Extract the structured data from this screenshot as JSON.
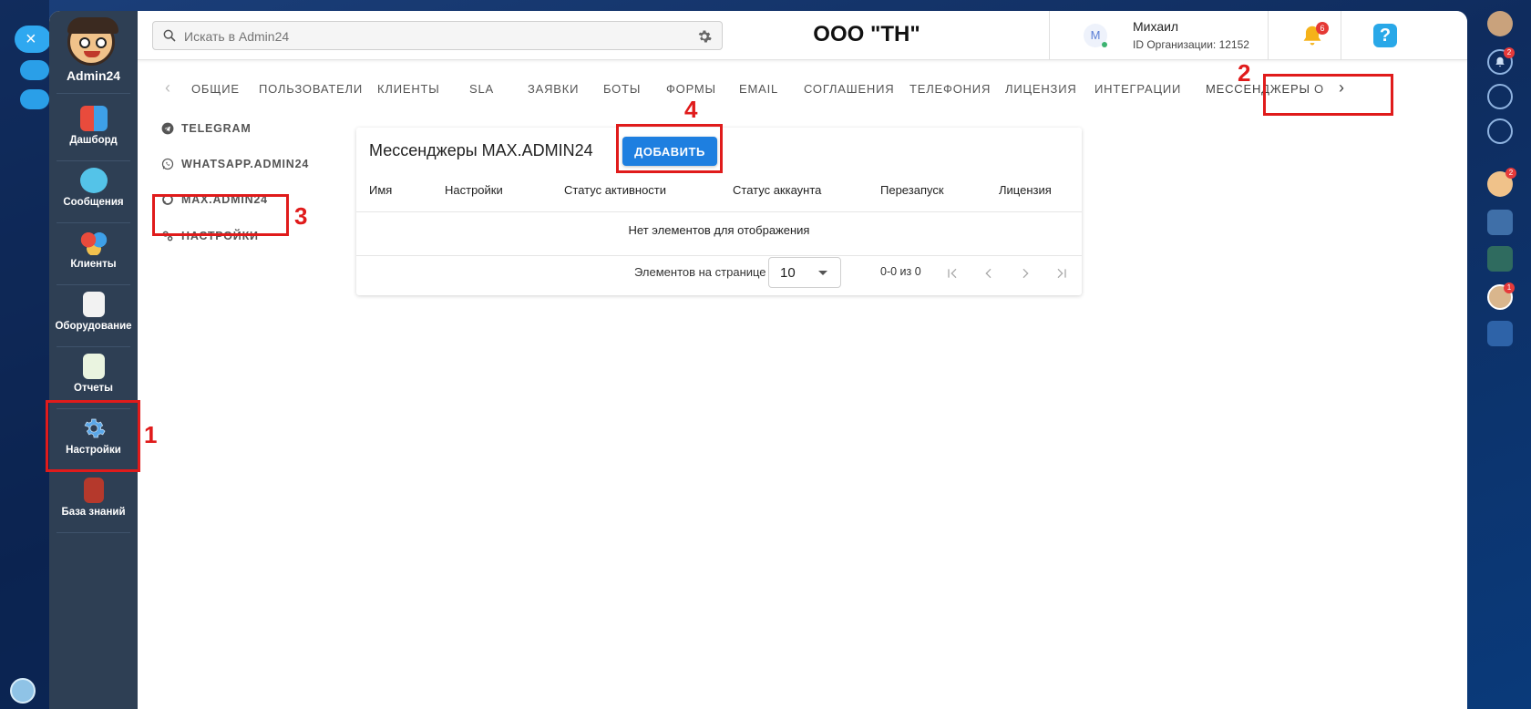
{
  "app": {
    "name": "Admin24",
    "org_title": "ООО \"ТН\""
  },
  "search": {
    "placeholder": "Искать в Admin24"
  },
  "user": {
    "initial": "М",
    "name": "Михаил",
    "org_id": "ID Организации: 12152"
  },
  "notifications": {
    "count": "6"
  },
  "help_label": "?",
  "nav": [
    {
      "label": "Дашборд",
      "icon": "dashboard-icon"
    },
    {
      "label": "Сообщения",
      "icon": "messages-icon"
    },
    {
      "label": "Клиенты",
      "icon": "clients-icon"
    },
    {
      "label": "Оборудование",
      "icon": "equipment-icon"
    },
    {
      "label": "Отчеты",
      "icon": "reports-icon"
    },
    {
      "label": "Настройки",
      "icon": "settings-gear-icon"
    },
    {
      "label": "База знаний",
      "icon": "knowledge-base-icon"
    }
  ],
  "tabs": [
    "ОБЩИЕ",
    "ПОЛЬЗОВАТЕЛИ",
    "КЛИЕНТЫ",
    "SLA",
    "ЗАЯВКИ",
    "БОТЫ",
    "ФОРМЫ",
    "EMAIL",
    "СОГЛАШЕНИЯ",
    "ТЕЛЕФОНИЯ",
    "ЛИЦЕНЗИЯ",
    "ИНТЕГРАЦИИ",
    "МЕССЕНДЖЕРЫ",
    "О"
  ],
  "active_tab": "МЕССЕНДЖЕРЫ",
  "subnav": [
    {
      "label": "TELEGRAM",
      "icon": "telegram-icon"
    },
    {
      "label": "WHATSAPP.ADMIN24",
      "icon": "whatsapp-icon"
    },
    {
      "label": "MAX.ADMIN24",
      "icon": "max-chat-icon"
    },
    {
      "label": "НАСТРОЙКИ",
      "icon": "settings-cogs-icon"
    }
  ],
  "card": {
    "title": "Мессенджеры MAX.ADMIN24",
    "add_button": "ДОБАВИТЬ",
    "columns": [
      "Имя",
      "Настройки",
      "Статус активности",
      "Статус аккаунта",
      "Перезапуск",
      "Лицензия"
    ],
    "empty_text": "Нет элементов для отображения",
    "per_page_label": "Элементов на странице",
    "per_page_value": "10",
    "range_text": "0-0 из 0"
  },
  "annotations": [
    "1",
    "2",
    "3",
    "4"
  ],
  "right_badges": [
    "2",
    "2",
    "1"
  ],
  "colors": {
    "accent": "#1e7fe0",
    "nav_bg": "#2e3f54",
    "annotation": "#e01b1b"
  }
}
